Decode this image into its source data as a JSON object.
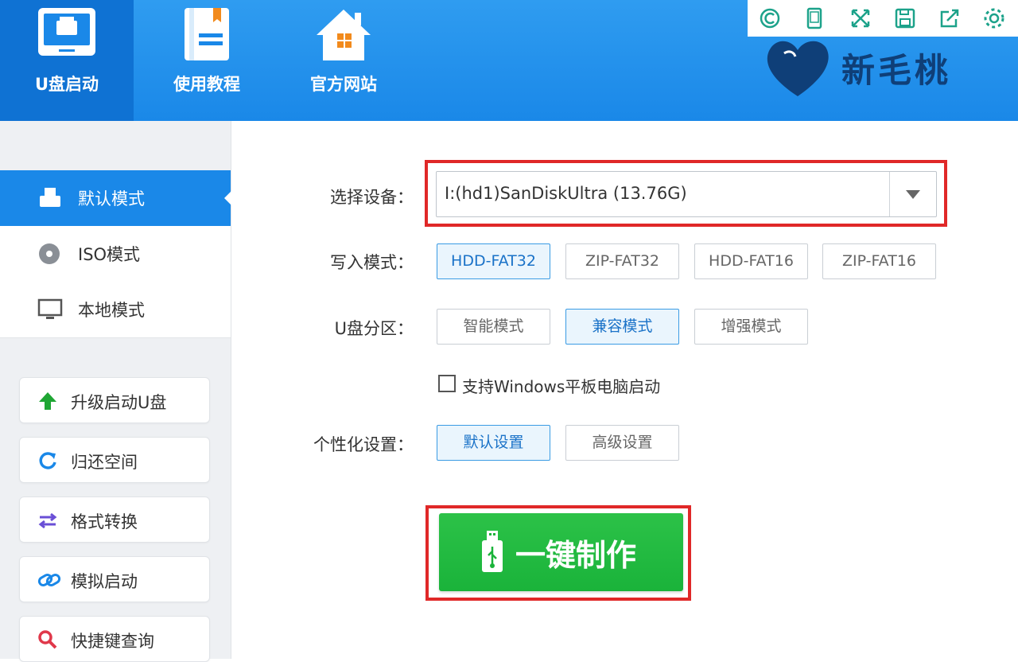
{
  "header": {
    "nav": [
      {
        "label": "U盘启动",
        "icon": "monitor-icon",
        "active": true
      },
      {
        "label": "使用教程",
        "icon": "book-icon",
        "active": false
      },
      {
        "label": "官方网站",
        "icon": "house-icon",
        "active": false
      }
    ],
    "toolbar_icons": [
      "support-icon",
      "tablet-icon",
      "fullscreen-icon",
      "save-icon",
      "share-icon",
      "gear-icon"
    ],
    "logo_text": "新毛桃"
  },
  "sidebar": {
    "modes": [
      {
        "label": "默认模式",
        "icon": "usb-drive-icon",
        "active": true
      },
      {
        "label": "ISO模式",
        "icon": "disc-icon",
        "active": false
      },
      {
        "label": "本地模式",
        "icon": "monitor-icon",
        "active": false
      }
    ],
    "tools": [
      {
        "label": "升级启动U盘",
        "icon": "up-arrow-icon"
      },
      {
        "label": "归还空间",
        "icon": "refresh-icon"
      },
      {
        "label": "格式转换",
        "icon": "swap-arrows-icon"
      },
      {
        "label": "模拟启动",
        "icon": "link-icon"
      },
      {
        "label": "快捷键查询",
        "icon": "search-icon"
      }
    ]
  },
  "form": {
    "device_label": "选择设备：",
    "device_value": "I:(hd1)SanDiskUltra (13.76G)",
    "write_mode_label": "写入模式：",
    "write_modes": [
      {
        "label": "HDD-FAT32",
        "selected": true
      },
      {
        "label": "ZIP-FAT32",
        "selected": false
      },
      {
        "label": "HDD-FAT16",
        "selected": false
      },
      {
        "label": "ZIP-FAT16",
        "selected": false
      }
    ],
    "partition_label": "U盘分区：",
    "partitions": [
      {
        "label": "智能模式",
        "selected": false
      },
      {
        "label": "兼容模式",
        "selected": true
      },
      {
        "label": "增强模式",
        "selected": false
      }
    ],
    "tablet_checkbox_label": "支持Windows平板电脑启动",
    "tablet_checked": false,
    "custom_label": "个性化设置：",
    "customs": [
      {
        "label": "默认设置",
        "selected": true
      },
      {
        "label": "高级设置",
        "selected": false
      }
    ],
    "make_button_label": "一键制作"
  },
  "colors": {
    "header_blue": "#1a88e8",
    "highlight_red": "#e02828",
    "make_green": "#1ab33a"
  }
}
